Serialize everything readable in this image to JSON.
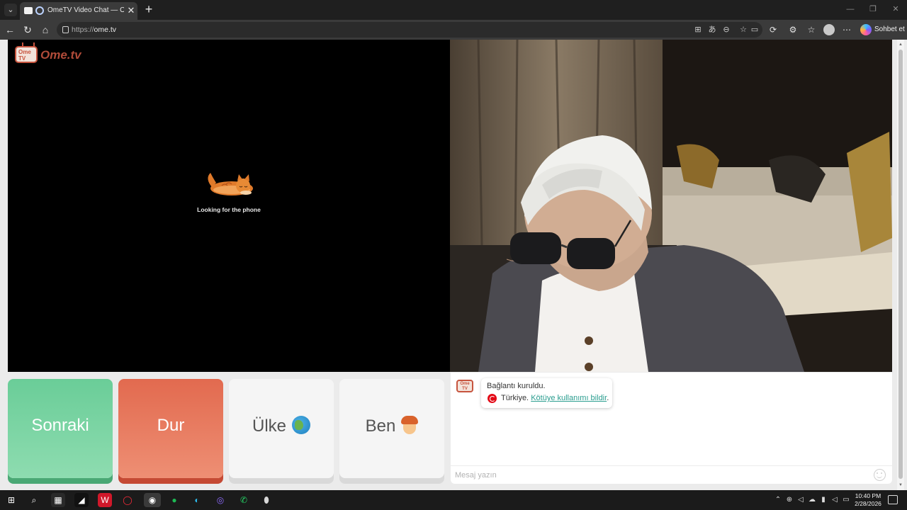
{
  "browser": {
    "tab_title": "OmeTV Video Chat — Omegle",
    "tab_close": "✕",
    "new_tab": "+",
    "url_protocol": "https://",
    "url_host": "ome.tv",
    "copilot_label": "Sohbet et"
  },
  "page": {
    "logo_tv": "Ome TV",
    "logo_text": "Ome.tv",
    "searching_text": "Looking for the phone"
  },
  "buttons": {
    "next": "Sonraki",
    "stop": "Dur",
    "country": "Ülke",
    "me": "Ben"
  },
  "chat": {
    "logo_text": "Ome TV",
    "status_message": "Bağlantı kuruldu.",
    "country_name": "Türkiye.",
    "report_link": "Kötüye kullanımı bildir",
    "report_suffix": ".",
    "input_placeholder": "Mesaj yazın"
  },
  "taskbar": {
    "time": "10:40 PM",
    "date": "2/28/2026"
  },
  "colors": {
    "next_green": "#6acd98",
    "stop_red": "#e26a4f",
    "link_teal": "#2a9d8f",
    "brand_red": "#c7543e"
  },
  "icons": {
    "tab_menu": "chevron-down-icon",
    "back": "back-arrow-icon",
    "reload": "reload-icon",
    "home": "home-icon",
    "favorite": "star-icon",
    "emoji": "smiley-icon"
  }
}
